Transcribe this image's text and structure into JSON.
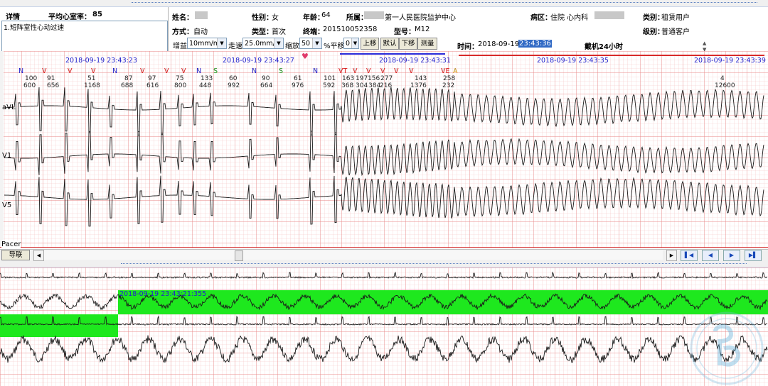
{
  "left_panel": {
    "detail_label": "详情",
    "avg_hr_label": "平均心室率：",
    "avg_hr_value": "85",
    "diagnosis": "1.短阵室性心动过速"
  },
  "patient": {
    "name_label": "姓名：",
    "name_value": "▓▓",
    "sex_label": "性别：",
    "sex_value": "女",
    "age_label": "年龄：",
    "age_value": "64",
    "org_label": "所属：",
    "org_value": "第一人民医院监护中心",
    "ward_label": "病区：",
    "ward_value": "住院  心内科",
    "category_label": "类别：",
    "category_value": "租赁用户",
    "mode_label": "方式：",
    "mode_value": "自动",
    "type_label": "类型：",
    "type_value": "首次",
    "terminal_label": "终端：",
    "terminal_value": "201510052358",
    "model_label": "型号：",
    "model_value": "M12",
    "time_label": "时间：",
    "time_date": "2018-09-19",
    "time_clock": "23:43:36",
    "wear_label": "戴机24小时",
    "level_label": "级别：",
    "level_value": "普通客户"
  },
  "toolbar": {
    "gain_label": "增益",
    "gain_value": "10mm/mv",
    "speed_label": "走速",
    "speed_value": "25.0mm/s",
    "zoom_label": "缩放",
    "zoom_value": "50",
    "shift_label": "%平移",
    "shift_value": "0",
    "up_button": "上移",
    "default_button": "默认",
    "down_button": "下移",
    "measure_button": "测量"
  },
  "ecg": {
    "timestamps": [
      "2018-09-19 23:43:23",
      "2018-09-19 23:43:27",
      "2018-09-19 23:43:31",
      "2018-09-19 23:43:35",
      "2018-09-19 23:43:39"
    ],
    "beat_labels": [
      "N",
      "V",
      "V",
      "V",
      "N",
      "V",
      "V",
      "V",
      "N",
      "S",
      "N",
      "S",
      "N",
      "VT",
      "V",
      "V",
      "V",
      "V",
      "V",
      "VE",
      "A"
    ],
    "hr_values": [
      "100",
      "91",
      "51",
      "87",
      "97",
      "75",
      "133",
      "60",
      "90",
      "61",
      "101",
      "163",
      "197",
      "156",
      "277",
      "143",
      "258",
      "4"
    ],
    "rr_values": [
      "600",
      "656",
      "1168",
      "688",
      "616",
      "800",
      "448",
      "992",
      "664",
      "976",
      "592",
      "368",
      "304",
      "384",
      "216",
      "1376",
      "232",
      "12600"
    ],
    "leads": [
      "aVL",
      "V1",
      "V5",
      "Pacer"
    ],
    "lead_button": "导联",
    "overview_timestamp": "2018-09-19 23:43:21:355"
  },
  "colors": {
    "grid_minor": "#f4b9b9",
    "grid_major": "#e87878",
    "selection_green": "#1ee81e",
    "beat_N": "#1c1ccc",
    "beat_V": "#d81818",
    "beat_S": "#149614",
    "timestamp": "#2222cc"
  }
}
